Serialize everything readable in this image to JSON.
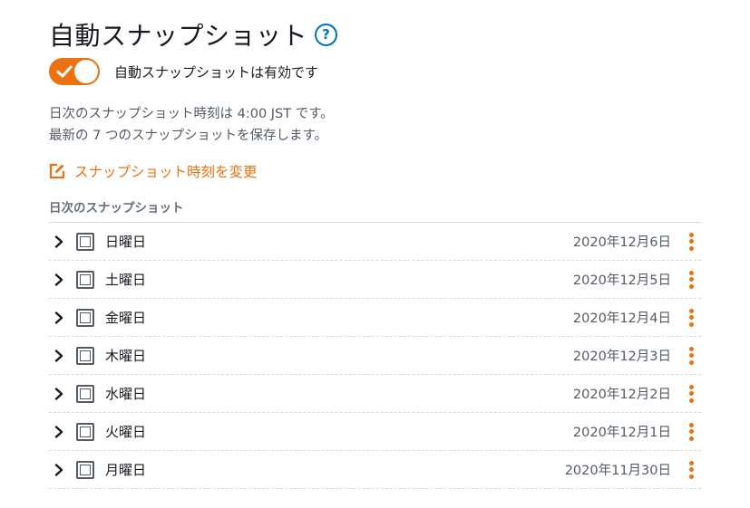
{
  "header": {
    "title": "自動スナップショット",
    "help_symbol": "?"
  },
  "toggle": {
    "state": "on",
    "label": "自動スナップショットは有効です"
  },
  "description": {
    "line1": "日次のスナップショット時刻は 4:00 JST です。",
    "line2": "最新の 7 つのスナップショットを保存します。"
  },
  "change_link": {
    "label": "スナップショット時刻を変更"
  },
  "snapshots": {
    "header": "日次のスナップショット",
    "items": [
      {
        "day": "日曜日",
        "date": "2020年12月6日"
      },
      {
        "day": "土曜日",
        "date": "2020年12月5日"
      },
      {
        "day": "金曜日",
        "date": "2020年12月4日"
      },
      {
        "day": "木曜日",
        "date": "2020年12月3日"
      },
      {
        "day": "水曜日",
        "date": "2020年12月2日"
      },
      {
        "day": "火曜日",
        "date": "2020年12月1日"
      },
      {
        "day": "月曜日",
        "date": "2020年11月30日"
      }
    ]
  },
  "colors": {
    "accent": "#ec7211",
    "help": "#0073bb",
    "text": "#16191f",
    "muted": "#545b64"
  }
}
